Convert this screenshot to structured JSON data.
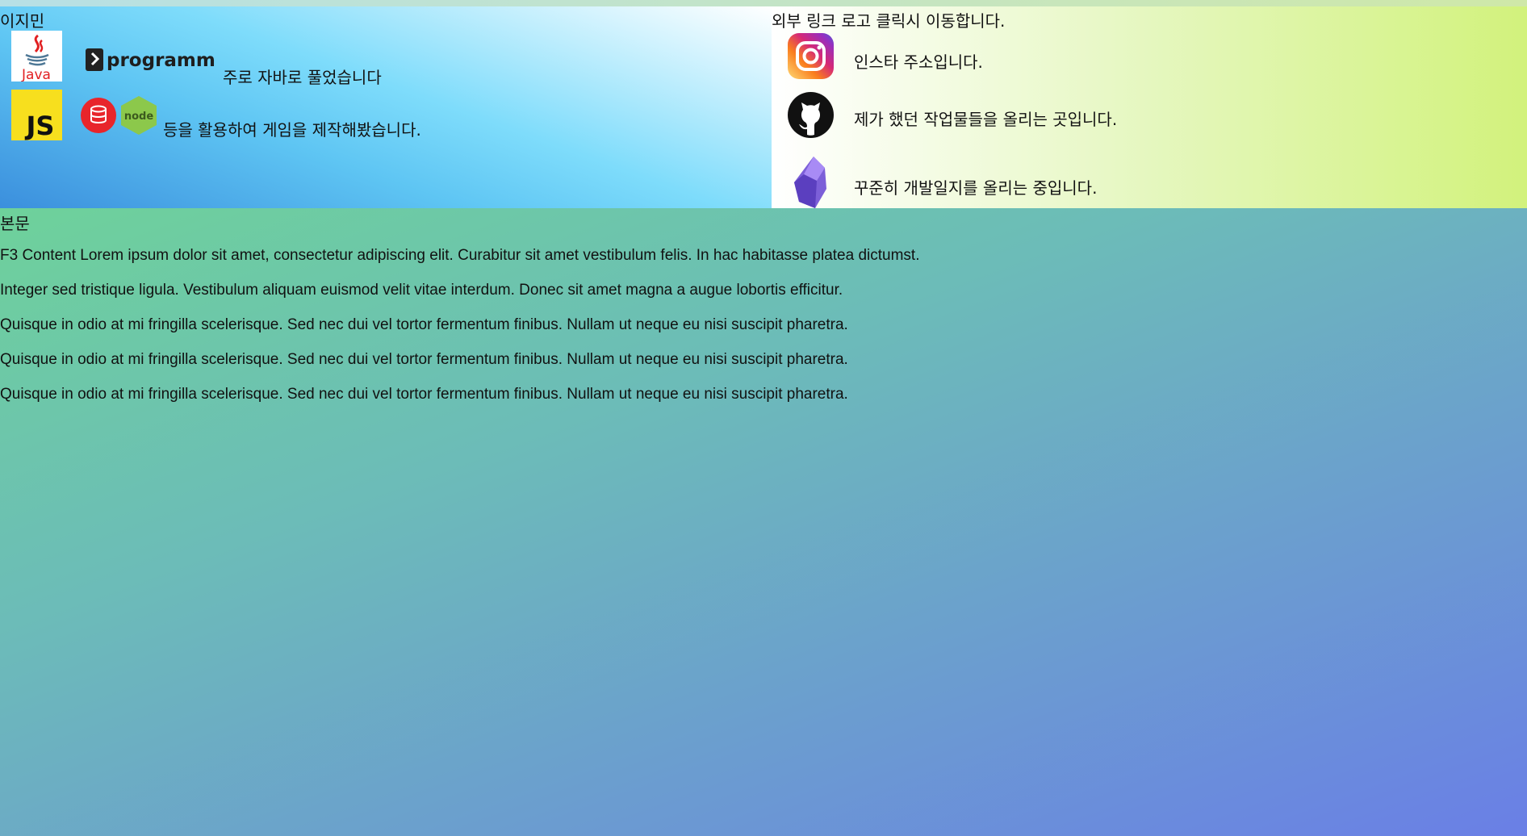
{
  "profile": {
    "name": "이지민",
    "logos": {
      "java": "Java",
      "programmers": "programmers",
      "javascript": "JS",
      "node": "node"
    },
    "java_text": "주로 자바로 풀었습니다",
    "js_text": "등을 활용하여 게임을 제작해봤습니다."
  },
  "links": {
    "heading": "외부 링크  로고 클릭시 이동합니다.",
    "items": [
      {
        "icon": "instagram-icon",
        "text": "인스타 주소입니다."
      },
      {
        "icon": "github-icon",
        "text": "제가 했던 작업물들을 올리는 곳입니다."
      },
      {
        "icon": "obsidian-icon",
        "text": "꾸준히 개발일지를 올리는 중입니다."
      }
    ]
  },
  "main": {
    "title": "본문",
    "paragraphs": [
      "F3 Content Lorem ipsum dolor sit amet, consectetur adipiscing elit. Curabitur sit amet vestibulum felis. In hac habitasse platea dictumst.",
      "Integer sed tristique ligula. Vestibulum aliquam euismod velit vitae interdum. Donec sit amet magna a augue lobortis efficitur.",
      "Quisque in odio at mi fringilla scelerisque. Sed nec dui vel tortor fermentum finibus. Nullam ut neque eu nisi suscipit pharetra.",
      "Quisque in odio at mi fringilla scelerisque. Sed nec dui vel tortor fermentum finibus. Nullam ut neque eu nisi suscipit pharetra.",
      "Quisque in odio at mi fringilla scelerisque. Sed nec dui vel tortor fermentum finibus. Nullam ut neque eu nisi suscipit pharetra."
    ]
  },
  "colors": {
    "java_red": "#e11f21",
    "java_blue": "#4e7896",
    "js_yellow": "#f7df1e",
    "oracle_red": "#e8252b",
    "node_green": "#8cc84b",
    "obsidian_purple": "#7c5fd8"
  }
}
